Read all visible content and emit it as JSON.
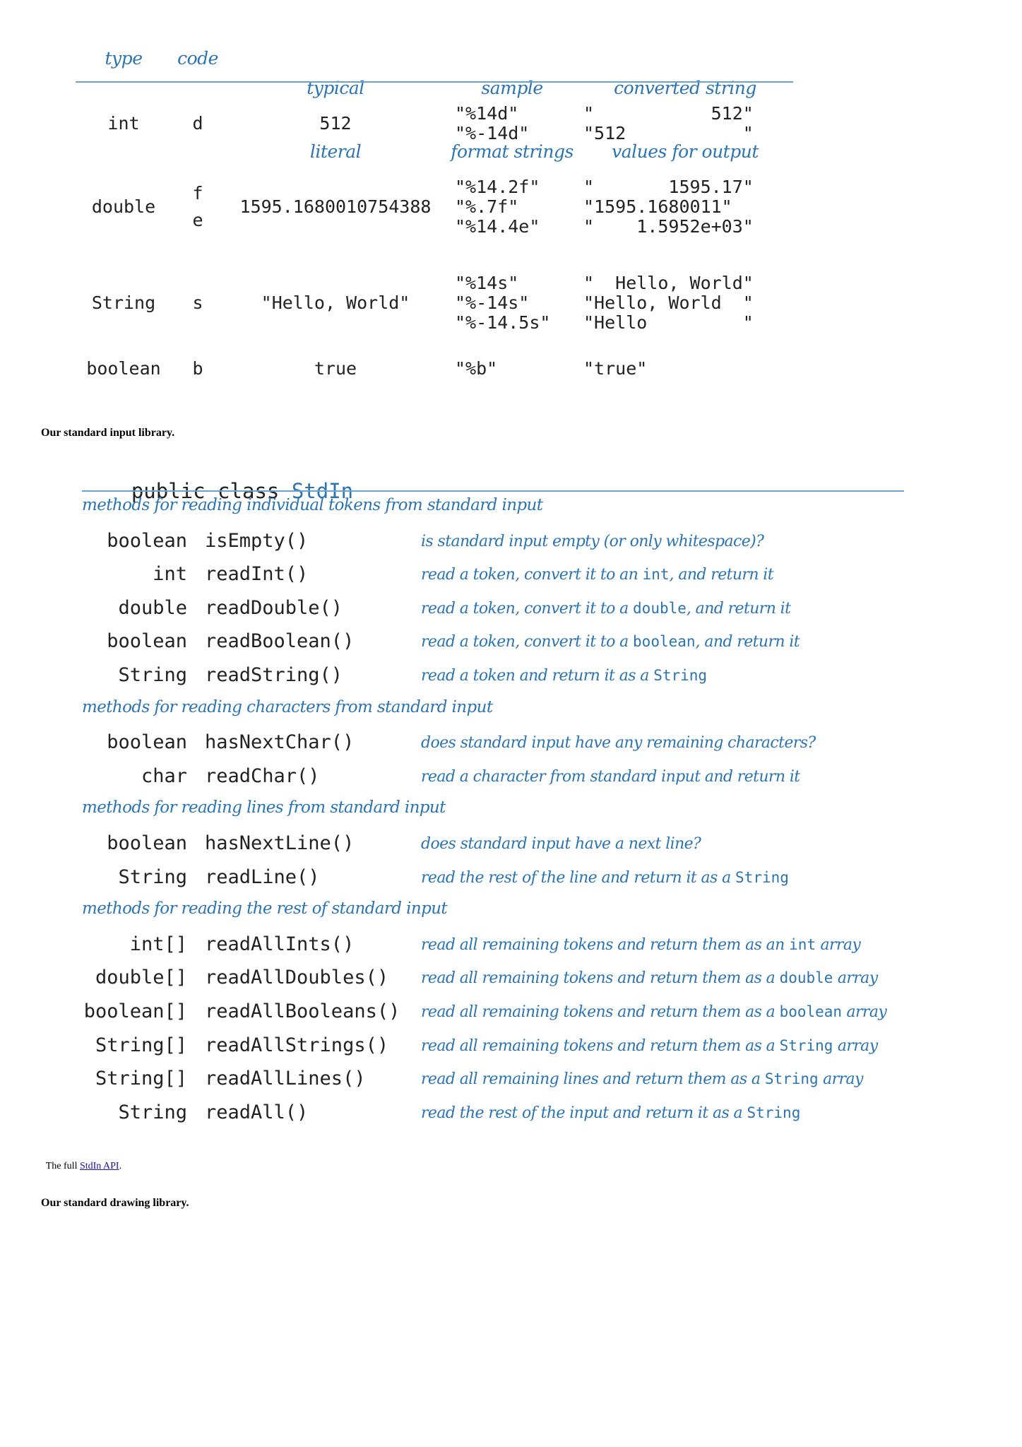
{
  "format_table": {
    "headers": {
      "type": "type",
      "code": "code",
      "typical_literal": [
        "typical",
        "literal"
      ],
      "sample_format": [
        "sample",
        "format strings"
      ],
      "converted": [
        "converted string",
        "values for output"
      ]
    },
    "rows": [
      {
        "type": "int",
        "codes": [
          "d"
        ],
        "literal": "512",
        "formats": [
          "\"%14d\"",
          "\"%-14d\""
        ],
        "outputs": [
          "\"           512\"",
          "\"512           \""
        ]
      },
      {
        "type": "double",
        "codes": [
          "f",
          "e"
        ],
        "literal": "1595.1680010754388",
        "formats": [
          "\"%14.2f\"",
          "\"%.7f\"",
          "\"%14.4e\""
        ],
        "outputs": [
          "\"       1595.17\"",
          "\"1595.1680011\"",
          "\"    1.5952e+03\""
        ]
      },
      {
        "type": "String",
        "codes": [
          "s"
        ],
        "literal": "\"Hello, World\"",
        "formats": [
          "\"%14s\"",
          "\"%-14s\"",
          "\"%-14.5s\""
        ],
        "outputs": [
          "\"  Hello, World\"",
          "\"Hello, World  \"",
          "\"Hello         \""
        ]
      },
      {
        "type": "boolean",
        "codes": [
          "b"
        ],
        "literal": "true",
        "formats": [
          "\"%b\""
        ],
        "outputs": [
          "\"true\""
        ]
      }
    ]
  },
  "stdin_caption": "Our standard input library.",
  "api": {
    "declaration_prefix": "public class ",
    "class_name": "StdIn",
    "sections": [
      {
        "heading": "methods for reading individual tokens from standard input",
        "methods": [
          {
            "ret": "boolean",
            "sig": "isEmpty()",
            "desc": [
              {
                "t": "is standard input empty (or only whitespace)?"
              }
            ]
          },
          {
            "ret": "int",
            "sig": "readInt()",
            "desc": [
              {
                "t": "read a token, convert it to an "
              },
              {
                "c": "int"
              },
              {
                "t": ", and return it"
              }
            ]
          },
          {
            "ret": "double",
            "sig": "readDouble()",
            "desc": [
              {
                "t": "read a token, convert it to a "
              },
              {
                "c": "double"
              },
              {
                "t": ", and return it"
              }
            ]
          },
          {
            "ret": "boolean",
            "sig": "readBoolean()",
            "desc": [
              {
                "t": "read a token, convert it to a "
              },
              {
                "c": "boolean"
              },
              {
                "t": ", and return it"
              }
            ]
          },
          {
            "ret": "String",
            "sig": "readString()",
            "desc": [
              {
                "t": "read a token and return it as a "
              },
              {
                "c": "String"
              }
            ]
          }
        ]
      },
      {
        "heading": "methods for reading characters from standard input",
        "methods": [
          {
            "ret": "boolean",
            "sig": "hasNextChar()",
            "desc": [
              {
                "t": "does standard input have any remaining characters?"
              }
            ]
          },
          {
            "ret": "char",
            "sig": "readChar()",
            "desc": [
              {
                "t": "read a character from standard input and return it"
              }
            ]
          }
        ]
      },
      {
        "heading": "methods for reading lines from standard input",
        "methods": [
          {
            "ret": "boolean",
            "sig": "hasNextLine()",
            "desc": [
              {
                "t": "does standard input have a next line?"
              }
            ]
          },
          {
            "ret": "String",
            "sig": "readLine()",
            "desc": [
              {
                "t": "read the rest of the line and return it as a "
              },
              {
                "c": "String"
              }
            ]
          }
        ]
      },
      {
        "heading": "methods for reading the rest of standard input",
        "methods": [
          {
            "ret": "int[]",
            "sig": "readAllInts()",
            "desc": [
              {
                "t": "read all remaining tokens and return them as an "
              },
              {
                "c": "int"
              },
              {
                "t": " array"
              }
            ]
          },
          {
            "ret": "double[]",
            "sig": "readAllDoubles()",
            "desc": [
              {
                "t": "read all remaining tokens and return them as a "
              },
              {
                "c": "double"
              },
              {
                "t": " array"
              }
            ]
          },
          {
            "ret": "boolean[]",
            "sig": "readAllBooleans()",
            "desc": [
              {
                "t": "read all remaining tokens and return them as a "
              },
              {
                "c": "boolean"
              },
              {
                "t": " array"
              }
            ]
          },
          {
            "ret": "String[]",
            "sig": "readAllStrings()",
            "desc": [
              {
                "t": "read all remaining tokens and return them as a "
              },
              {
                "c": "String"
              },
              {
                "t": " array"
              }
            ]
          },
          {
            "ret": "String[]",
            "sig": "readAllLines()",
            "desc": [
              {
                "t": "read all remaining lines and return them as a "
              },
              {
                "c": "String"
              },
              {
                "t": " array"
              }
            ]
          },
          {
            "ret": "String",
            "sig": "readAll()",
            "desc": [
              {
                "t": "read the rest of the input and return it as a "
              },
              {
                "c": "String"
              }
            ]
          }
        ]
      }
    ]
  },
  "full_api": {
    "prefix": "The full ",
    "link_text": "StdIn API",
    "suffix": "."
  },
  "stddraw_caption": "Our standard drawing library.",
  "colors": {
    "accent_blue": "#2a74b4",
    "rule_blue": "#6aa3cf",
    "link": "#1a0dab"
  }
}
